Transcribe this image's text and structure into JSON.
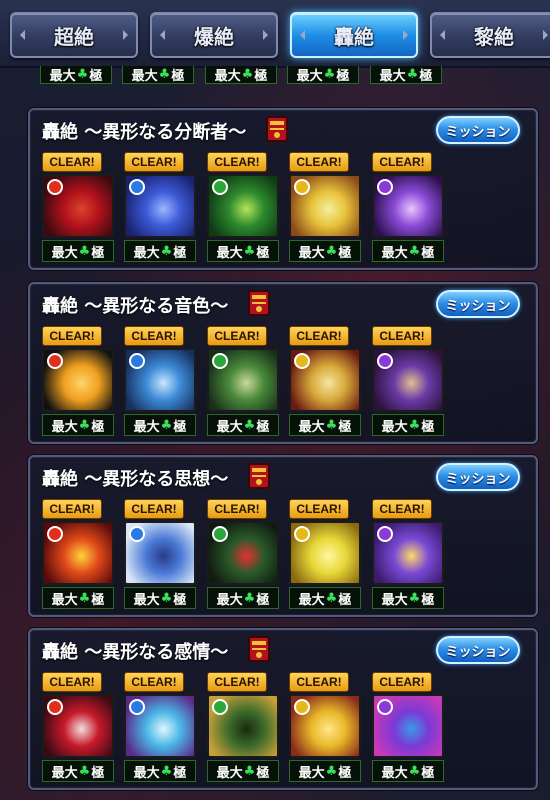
{
  "tabs": [
    {
      "label": "超絶",
      "active": false
    },
    {
      "label": "爆絶",
      "active": false
    },
    {
      "label": "轟絶",
      "active": true
    },
    {
      "label": "黎絶",
      "active": false
    }
  ],
  "max_label": {
    "prefix": "最大",
    "suffix": "極",
    "clover": "♣"
  },
  "clear_label": "CLEAR!",
  "mission_label": "ミッション",
  "panels": [
    {
      "title": "轟絶 ～異形なる分断者～",
      "slots": [
        {
          "element": "fire",
          "colors": [
            "#b3121c",
            "#3a0a10",
            "#d8452a"
          ]
        },
        {
          "element": "water",
          "colors": [
            "#3c5bd6",
            "#1a2270",
            "#9ab6ff"
          ]
        },
        {
          "element": "wood",
          "colors": [
            "#2e8a2e",
            "#0e3a14",
            "#b2e65a"
          ]
        },
        {
          "element": "light",
          "colors": [
            "#e8c23a",
            "#8a4a1a",
            "#f3f0a0"
          ]
        },
        {
          "element": "dark",
          "colors": [
            "#8a4ad6",
            "#2a0f4a",
            "#e8c6ff"
          ]
        }
      ]
    },
    {
      "title": "轟絶 ～異形なる音色～",
      "slots": [
        {
          "element": "fire",
          "colors": [
            "#f0a020",
            "#111111",
            "#ffd36a"
          ]
        },
        {
          "element": "water",
          "colors": [
            "#3c8ad6",
            "#16305e",
            "#c8e6ff"
          ]
        },
        {
          "element": "wood",
          "colors": [
            "#4a8a3a",
            "#18301a",
            "#c8d8a0"
          ]
        },
        {
          "element": "light",
          "colors": [
            "#d8a83a",
            "#6a1a12",
            "#f5e5a0"
          ]
        },
        {
          "element": "dark",
          "colors": [
            "#6a3aa6",
            "#2a123a",
            "#e0c090"
          ]
        }
      ]
    },
    {
      "title": "轟絶 ～異形なる思想～",
      "slots": [
        {
          "element": "fire",
          "colors": [
            "#e04a1a",
            "#5a0a0a",
            "#ffd23a"
          ]
        },
        {
          "element": "water",
          "colors": [
            "#4a7ad6",
            "#d8e6f8",
            "#2a3a8a"
          ]
        },
        {
          "element": "wood",
          "colors": [
            "#2a5a2a",
            "#101a10",
            "#e83030"
          ]
        },
        {
          "element": "light",
          "colors": [
            "#e8d83a",
            "#8a6a10",
            "#fff6a0"
          ]
        },
        {
          "element": "dark",
          "colors": [
            "#7a4ad6",
            "#3a1a6a",
            "#ffd86a"
          ]
        }
      ]
    },
    {
      "title": "轟絶 ～異形なる感情～",
      "slots": [
        {
          "element": "fire",
          "colors": [
            "#c81a2a",
            "#3a0a14",
            "#f0e0e0"
          ]
        },
        {
          "element": "water",
          "colors": [
            "#4ab6e6",
            "#5a2a8a",
            "#e0f6ff"
          ]
        },
        {
          "element": "wood",
          "colors": [
            "#3a6a2a",
            "#c8a03a",
            "#1a2a10"
          ]
        },
        {
          "element": "light",
          "colors": [
            "#e8b82a",
            "#8a2a1a",
            "#ffe68a"
          ]
        },
        {
          "element": "dark",
          "colors": [
            "#7a3ad6",
            "#c83ab6",
            "#3a9ae6"
          ]
        }
      ]
    }
  ],
  "element_colors": {
    "fire": "#e0301a",
    "water": "#2a7ae6",
    "wood": "#2aa63a",
    "light": "#e6b81a",
    "dark": "#8a3ad6"
  }
}
